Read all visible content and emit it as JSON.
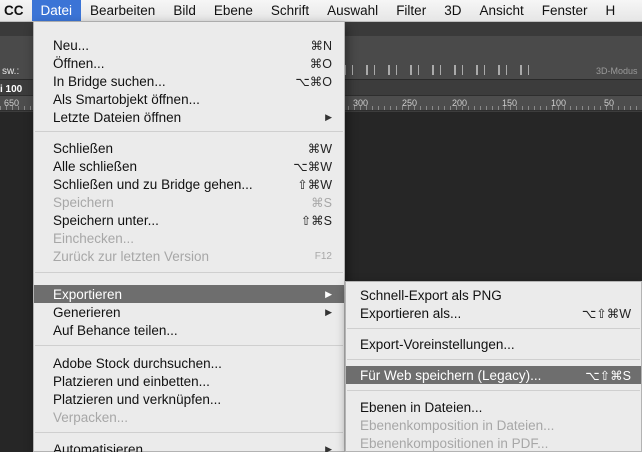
{
  "menubar": {
    "items": [
      {
        "label": "CC"
      },
      {
        "label": "Datei"
      },
      {
        "label": "Bearbeiten"
      },
      {
        "label": "Bild"
      },
      {
        "label": "Ebene"
      },
      {
        "label": "Schrift"
      },
      {
        "label": "Auswahl"
      },
      {
        "label": "Filter"
      },
      {
        "label": "3D"
      },
      {
        "label": "Ansicht"
      },
      {
        "label": "Fenster"
      },
      {
        "label": "H"
      }
    ]
  },
  "background": {
    "options_label": "sw.:",
    "mode_label": "3D-Modus",
    "tab_label": "i 100",
    "ruler_labels": [
      "650",
      "300",
      "250",
      "200",
      "150",
      "100",
      "50"
    ]
  },
  "file_menu": {
    "items": [
      {
        "label": "Neu...",
        "shortcut": "⌘N"
      },
      {
        "label": "Öffnen...",
        "shortcut": "⌘O"
      },
      {
        "label": "In Bridge suchen...",
        "shortcut": "⌥⌘O"
      },
      {
        "label": "Als Smartobjekt öffnen...",
        "shortcut": ""
      },
      {
        "label": "Letzte Dateien öffnen",
        "shortcut": "",
        "submenu": true
      },
      {
        "label": "Schließen",
        "shortcut": "⌘W"
      },
      {
        "label": "Alle schließen",
        "shortcut": "⌥⌘W"
      },
      {
        "label": "Schließen und zu Bridge gehen...",
        "shortcut": "⇧⌘W"
      },
      {
        "label": "Speichern",
        "shortcut": "⌘S",
        "disabled": true
      },
      {
        "label": "Speichern unter...",
        "shortcut": "⇧⌘S"
      },
      {
        "label": "Einchecken...",
        "shortcut": "",
        "disabled": true
      },
      {
        "label": "Zurück zur letzten Version",
        "shortcut": "F12",
        "disabled": true
      },
      {
        "label": "Exportieren",
        "shortcut": "",
        "submenu": true,
        "highlighted": true
      },
      {
        "label": "Generieren",
        "shortcut": "",
        "submenu": true
      },
      {
        "label": "Auf Behance teilen...",
        "shortcut": ""
      },
      {
        "label": "Adobe Stock durchsuchen...",
        "shortcut": ""
      },
      {
        "label": "Platzieren und einbetten...",
        "shortcut": ""
      },
      {
        "label": "Platzieren und verknüpfen...",
        "shortcut": ""
      },
      {
        "label": "Verpacken...",
        "shortcut": "",
        "disabled": true
      },
      {
        "label": "Automatisieren",
        "shortcut": "",
        "submenu": true
      }
    ]
  },
  "export_submenu": {
    "items": [
      {
        "label": "Schnell-Export als PNG",
        "shortcut": ""
      },
      {
        "label": "Exportieren als...",
        "shortcut": "⌥⇧⌘W"
      },
      {
        "label": "Export-Voreinstellungen...",
        "shortcut": ""
      },
      {
        "label": "Für Web speichern (Legacy)...",
        "shortcut": "⌥⇧⌘S",
        "highlighted": true
      },
      {
        "label": "Ebenen in Dateien...",
        "shortcut": ""
      },
      {
        "label": "Ebenenkomposition in Dateien...",
        "shortcut": "",
        "disabled": true
      },
      {
        "label": "Ebenenkompositionen in PDF...",
        "shortcut": "",
        "disabled": true
      }
    ]
  },
  "colors": {
    "menubar_active": "#3b74d6",
    "menu_highlight": "#6e6e6e",
    "menu_bg": "#ebebeb",
    "disabled_text": "#a7a7a7"
  }
}
